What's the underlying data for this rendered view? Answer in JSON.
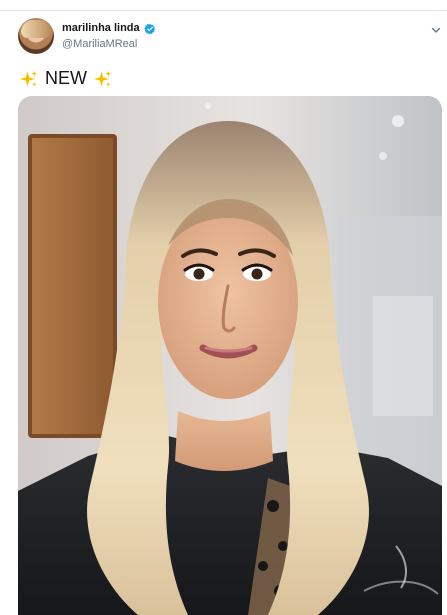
{
  "tweet": {
    "author_name": "marilinha linda",
    "author_handle": "@MariliaMReal",
    "text": "NEW",
    "icons": {
      "verified": "verified-badge-icon",
      "sparkle": "sparkles-icon",
      "caret": "chevron-down-icon"
    },
    "colors": {
      "verified": "#1da1f2",
      "sparkle": "#f5c000",
      "divider": "#e6ecf0"
    }
  }
}
